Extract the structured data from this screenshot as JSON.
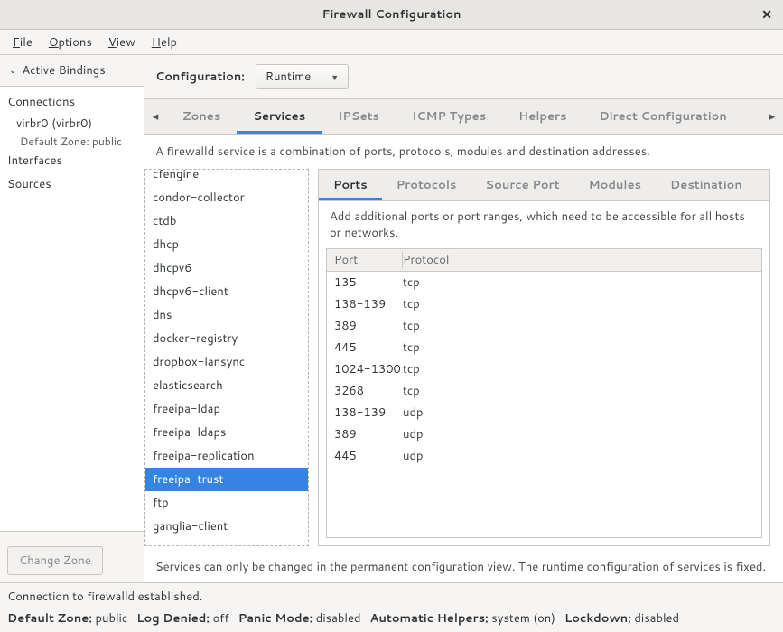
{
  "window_title": "Firewall Configuration",
  "menus": {
    "file": "File",
    "options": "Options",
    "view": "View",
    "help": "Help"
  },
  "left": {
    "bindings_header": "Active Bindings",
    "connections_label": "Connections",
    "connection": {
      "name": "virbr0 (virbr0)",
      "zone_note": "Default Zone: public"
    },
    "interfaces_label": "Interfaces",
    "sources_label": "Sources",
    "change_zone": "Change Zone"
  },
  "config": {
    "label": "Configuration:",
    "value": "Runtime"
  },
  "tabs": [
    "Zones",
    "Services",
    "IPSets",
    "ICMP Types",
    "Helpers",
    "Direct Configuration"
  ],
  "tabs_active": 1,
  "service_desc": "A firewalld service is a combination of ports, protocols, modules and destination addresses.",
  "services": [
    "cfengine",
    "condor-collector",
    "ctdb",
    "dhcp",
    "dhcpv6",
    "dhcpv6-client",
    "dns",
    "docker-registry",
    "dropbox-lansync",
    "elasticsearch",
    "freeipa-ldap",
    "freeipa-ldaps",
    "freeipa-replication",
    "freeipa-trust",
    "ftp",
    "ganglia-client"
  ],
  "service_selected": 13,
  "subtabs": [
    "Ports",
    "Protocols",
    "Source Port",
    "Modules",
    "Destination"
  ],
  "subtabs_active": 0,
  "ports_hint": "Add additional ports or port ranges, which need to be accessible for all hosts or networks.",
  "port_headers": {
    "port": "Port",
    "protocol": "Protocol"
  },
  "ports": [
    {
      "port": "135",
      "proto": "tcp"
    },
    {
      "port": "138-139",
      "proto": "tcp"
    },
    {
      "port": "389",
      "proto": "tcp"
    },
    {
      "port": "445",
      "proto": "tcp"
    },
    {
      "port": "1024-1300",
      "proto": "tcp"
    },
    {
      "port": "3268",
      "proto": "tcp"
    },
    {
      "port": "138-139",
      "proto": "udp"
    },
    {
      "port": "389",
      "proto": "udp"
    },
    {
      "port": "445",
      "proto": "udp"
    }
  ],
  "footer_note": "Services can only be changed in the permanent configuration view. The runtime configuration of services is fixed.",
  "status_connection": "Connection to firewalld established.",
  "status_fields": {
    "default_zone": {
      "label": "Default Zone:",
      "value": "public"
    },
    "log_denied": {
      "label": "Log Denied:",
      "value": "off"
    },
    "panic_mode": {
      "label": "Panic Mode:",
      "value": "disabled"
    },
    "auto_helpers": {
      "label": "Automatic Helpers:",
      "value": "system (on)"
    },
    "lockdown": {
      "label": "Lockdown:",
      "value": "disabled"
    }
  }
}
